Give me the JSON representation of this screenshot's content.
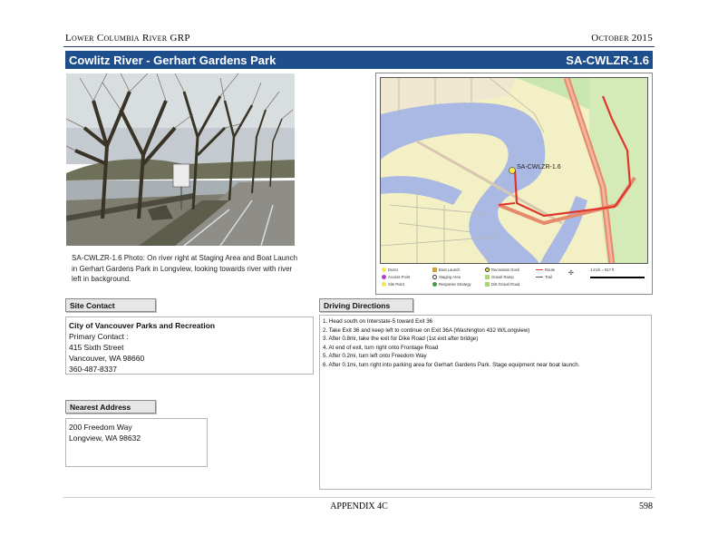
{
  "header": {
    "org": "Lower Columbia River GRP",
    "date": "October 2015"
  },
  "title": {
    "site_name": "Cowlitz River - Gerhart Gardens Park",
    "site_code": "SA-CWLZR-1.6"
  },
  "photo": {
    "caption": "SA-CWLZR-1.6 Photo: On river right at Staging Area and Boat Launch in Gerhart Gardens Park in Longview, looking towards river with river left in background."
  },
  "map": {
    "site_label": "SA-CWLZR-1.6",
    "legend": {
      "col1": [
        "Dozer",
        "Access Point",
        "Site Point"
      ],
      "col2": [
        "Boat Launch",
        "Staging Area",
        "Response Strategy"
      ],
      "col3": [
        "Recreation Dock",
        "Gravel Ramp",
        "Dirt Gravel Road"
      ],
      "col4": [
        "Route",
        "Trail"
      ],
      "scale": "1 inch = 917 ft"
    },
    "colors": {
      "water": "#aab9e3",
      "land": "#f2f0c4",
      "route": "#e0352b",
      "highway": "#e58a6d"
    }
  },
  "site_contact": {
    "label": "Site Contact",
    "org": "City of Vancouver Parks and Recreation",
    "primary": "Primary Contact :",
    "street": "415 Sixth Street",
    "city": "Vancouver, WA 98660",
    "phone": "360-487-8337"
  },
  "nearest_address": {
    "label": "Nearest Address",
    "street": "200 Freedom Way",
    "city": "Longview, WA 98632"
  },
  "driving_directions": {
    "label": "Driving Directions",
    "steps": [
      "1. Head south on Interstate-5 toward Exit 36",
      "2. Take Exit 36 and keep left to continue on Exit 36A (Washington 432 W/Longview)",
      "3. After 0.8mi, take the exit for Dike Road (1st exit after bridge)",
      "4. At end of exit, turn right onto Frontage Road",
      "5. After 0.2mi, turn left onto Freedom Way",
      "6. After 0.1mi, turn right into parking area for Gerhart Gardens Park. Stage equipment near boat launch."
    ]
  },
  "footer": {
    "appendix": "APPENDIX 4C",
    "page": "598"
  }
}
